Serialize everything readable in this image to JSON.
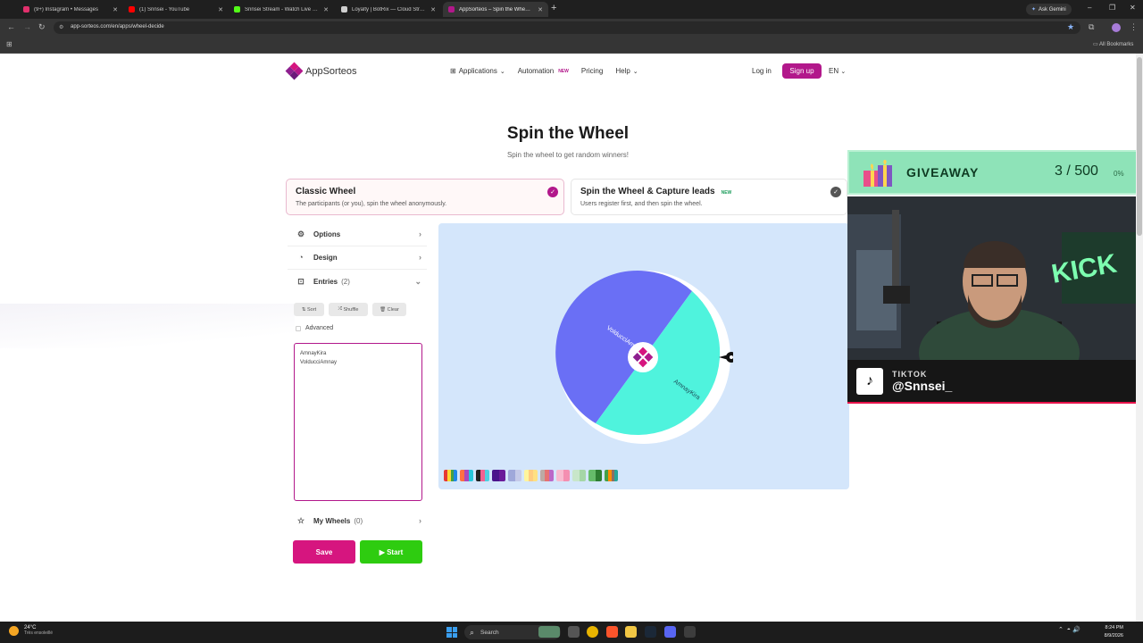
{
  "browser": {
    "tabs": [
      {
        "title": "(9+) Instagram • Messages",
        "color": "#e1306c"
      },
      {
        "title": "(1) Snnsei - YouTube",
        "color": "#ff0000"
      },
      {
        "title": "Snnsei Stream - Watch Live on Kick",
        "color": "#53fc18"
      },
      {
        "title": "Loyalty | BotRix — Cloud Stream",
        "color": "#cfcfcf"
      },
      {
        "title": "AppSorteos – Spin the Wheel (Pi",
        "color": "#b2188b"
      }
    ],
    "url": "app-sorteos.com/en/apps/wheel-decide",
    "ask_gemini": "Ask Gemini",
    "all_bookmarks": "All Bookmarks"
  },
  "site": {
    "logo_text": "AppSorteos",
    "nav": {
      "applications": "Applications",
      "automation": "Automation",
      "automation_badge": "NEW",
      "pricing": "Pricing",
      "help": "Help"
    },
    "login": "Log in",
    "signup": "Sign up",
    "language": "EN",
    "brand_color": "#b2188b"
  },
  "hero": {
    "title": "Spin the Wheel",
    "subtitle": "Spin the wheel to get random winners!"
  },
  "modes": {
    "classic": {
      "title": "Classic Wheel",
      "desc": "The participants (or you), spin the wheel anonymously."
    },
    "capture": {
      "title": "Spin the Wheel & Capture leads",
      "badge": "NEW",
      "desc": "Users register first, and then spin the wheel."
    }
  },
  "panel": {
    "options": "Options",
    "design": "Design",
    "entries_label": "Entries",
    "entries_count": "(2)",
    "sort": "Sort",
    "shuffle": "Shuffle",
    "clear": "Clear",
    "advanced": "Advanced",
    "entries": [
      "AmnayKira",
      "VolducciAmnay"
    ],
    "my_wheels": "My Wheels",
    "my_wheels_count": "(0)",
    "save": "Save",
    "start": "Start"
  },
  "wheel": {
    "segments": [
      {
        "label": "VolducciAmnay",
        "color": "#6a6ff5"
      },
      {
        "label": "AmnayKira",
        "color": "#4ff3dd"
      }
    ]
  },
  "overlay": {
    "giveaway_title": "GIVEAWAY",
    "giveaway_count": "3 / 500",
    "giveaway_pct": "0%",
    "platform": "TIKTOK",
    "handle": "@Snnsei_"
  },
  "taskbar": {
    "temp": "24°C",
    "weather": "Très ensoleillé",
    "search": "Search",
    "time": "8:24 PM",
    "date": "8/9/2026"
  }
}
